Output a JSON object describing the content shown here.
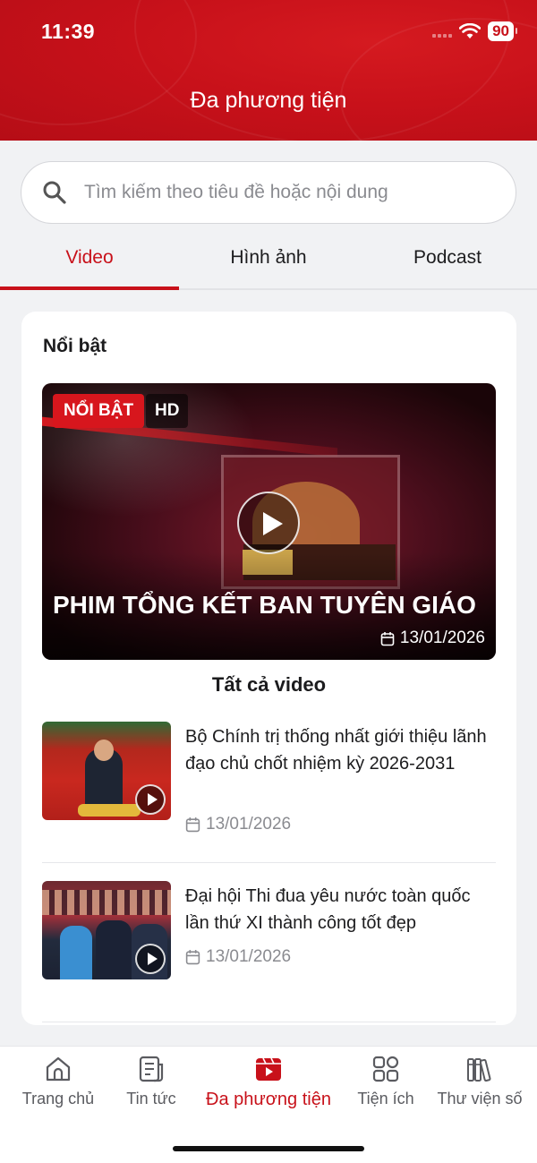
{
  "status": {
    "time": "11:39",
    "battery": "90"
  },
  "header": {
    "title": "Đa phương tiện"
  },
  "search": {
    "placeholder": "Tìm kiếm theo tiêu đề hoặc nội dung"
  },
  "tabs": [
    {
      "label": "Video",
      "active": true
    },
    {
      "label": "Hình ảnh",
      "active": false
    },
    {
      "label": "Podcast",
      "active": false
    }
  ],
  "featured_section": {
    "title": "Nổi bật",
    "badge": "NỔI BẬT",
    "quality": "HD",
    "video_title": "PHIM TỔNG KẾT BAN TUYÊN GIÁO",
    "date": "13/01/2026"
  },
  "all_videos": {
    "title": "Tất cả video"
  },
  "videos": [
    {
      "title": "Bộ Chính trị thống nhất giới thiệu lãnh đạo chủ chốt nhiệm kỳ 2026-2031",
      "date": "13/01/2026"
    },
    {
      "title": "Đại hội Thi đua yêu nước toàn quốc lần thứ XI thành công tốt đẹp",
      "date": "13/01/2026"
    }
  ],
  "bottom_nav": [
    {
      "label": "Trang chủ",
      "icon": "home-icon",
      "active": false
    },
    {
      "label": "Tin tức",
      "icon": "news-icon",
      "active": false
    },
    {
      "label": "Đa phương tiện",
      "icon": "multimedia-icon",
      "active": true
    },
    {
      "label": "Tiện ích",
      "icon": "apps-icon",
      "active": false
    },
    {
      "label": "Thư viện số",
      "icon": "library-icon",
      "active": false
    }
  ],
  "colors": {
    "brand": "#c8111a",
    "background": "#f1f2f4",
    "muted": "#8a8b90"
  }
}
